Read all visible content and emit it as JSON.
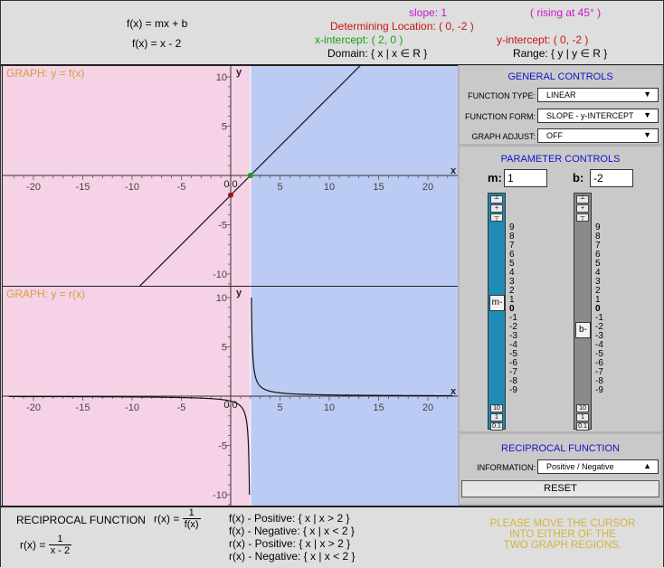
{
  "header": {
    "formula": "f(x) = mx + b",
    "formula_current": "f(x) = x - 2",
    "slope": "slope: 1",
    "rising": "( rising at 45° )",
    "determining_location": "Determining Location: ( 0, -2 )",
    "x_intercept": "x-intercept: ( 2, 0 )",
    "y_intercept": "y-intercept: ( 0, -2 )",
    "domain": "Domain: { x | x ∈ R }",
    "range": "Range: { y | y ∈ R }"
  },
  "graph1": {
    "title": "GRAPH: y = f(x)"
  },
  "graph2": {
    "title": "GRAPH: y = r(x)"
  },
  "axes": {
    "x_label": "x",
    "y_label": "y",
    "x_ticks": [
      -20,
      -15,
      -10,
      -5,
      5,
      10,
      15,
      20
    ],
    "y_ticks": [
      10,
      5,
      -5,
      -10
    ],
    "origin_label": "0 0",
    "xlim": [
      -22.5,
      22.5
    ],
    "ylim": [
      -11,
      10.5
    ]
  },
  "chart_data": [
    {
      "type": "line",
      "title": "GRAPH: y = f(x)",
      "function": "f(x) = x - 2",
      "x": [
        -22.5,
        22.5
      ],
      "y": [
        -24.5,
        20.5
      ],
      "points": {
        "x_intercept": [
          2,
          0
        ],
        "y_intercept": [
          0,
          -2
        ]
      }
    },
    {
      "type": "line",
      "title": "GRAPH: y = r(x)",
      "function": "r(x) = 1 / (x - 2)",
      "asymptote_x": 2,
      "x": [
        -22.5,
        -10,
        -5,
        0,
        1,
        1.5,
        1.9,
        2.1,
        2.5,
        3,
        5,
        10,
        22.5
      ],
      "y": [
        -0.0408,
        -0.0833,
        -0.1429,
        -0.5,
        -1,
        -2,
        -10,
        10,
        2,
        1,
        0.3333,
        0.125,
        0.0488
      ]
    }
  ],
  "regions": {
    "negative_color": "#f6d2e6",
    "positive_color": "#bccbf3",
    "boundary_x": 2
  },
  "panel": {
    "general_title": "GENERAL CONTROLS",
    "function_type_label": "FUNCTION TYPE:",
    "function_type_value": "LINEAR",
    "function_form_label": "FUNCTION FORM:",
    "function_form_value": "SLOPE - y-INTERCEPT",
    "graph_adjust_label": "GRAPH ADJUST:",
    "graph_adjust_value": "OFF",
    "param_title": "PARAMETER CONTROLS",
    "m_label": "m:",
    "m_value": "1",
    "b_label": "b:",
    "b_value": "-2",
    "step_top": [
      "┴",
      "+",
      "┬"
    ],
    "step_bottom": [
      "10",
      "1",
      "0.1"
    ],
    "m_thumb": "m-",
    "b_thumb": "b-",
    "scale": [
      "9",
      "8",
      "7",
      "6",
      "5",
      "4",
      "3",
      "2",
      "1",
      "0",
      "-1",
      "-2",
      "-3",
      "-4",
      "-5",
      "-6",
      "-7",
      "-8",
      "-9"
    ],
    "reciprocal_title": "RECIPROCAL FUNCTION",
    "info_label": "INFORMATION:",
    "info_value": "Positive / Negative",
    "reset": "RESET"
  },
  "footer": {
    "reciprocal_label": "RECIPROCAL FUNCTION",
    "r_def_left": "r(x) =",
    "r_def_num": "1",
    "r_def_den": "f(x)",
    "r_cur_left": "r(x) =",
    "r_cur_num": "1",
    "r_cur_den": "x - 2",
    "f_pos": "f(x) - Positive: { x | x > 2 }",
    "f_neg": "f(x) - Negative: { x | x < 2 }",
    "r_pos": "r(x) - Positive: { x | x > 2 }",
    "r_neg": "r(x) - Negative: { x | x < 2 }",
    "hint": [
      "PLEASE MOVE THE CURSOR",
      "INTO EITHER OF THE",
      "TWO GRAPH REGIONS."
    ]
  },
  "colors": {
    "header_red": "#c81414",
    "header_green": "#14a014",
    "header_magenta": "#c814c8",
    "title_gold": "#d2a040",
    "hint_gold": "#d2b43c",
    "slider_blue": "#1e8cb4"
  }
}
